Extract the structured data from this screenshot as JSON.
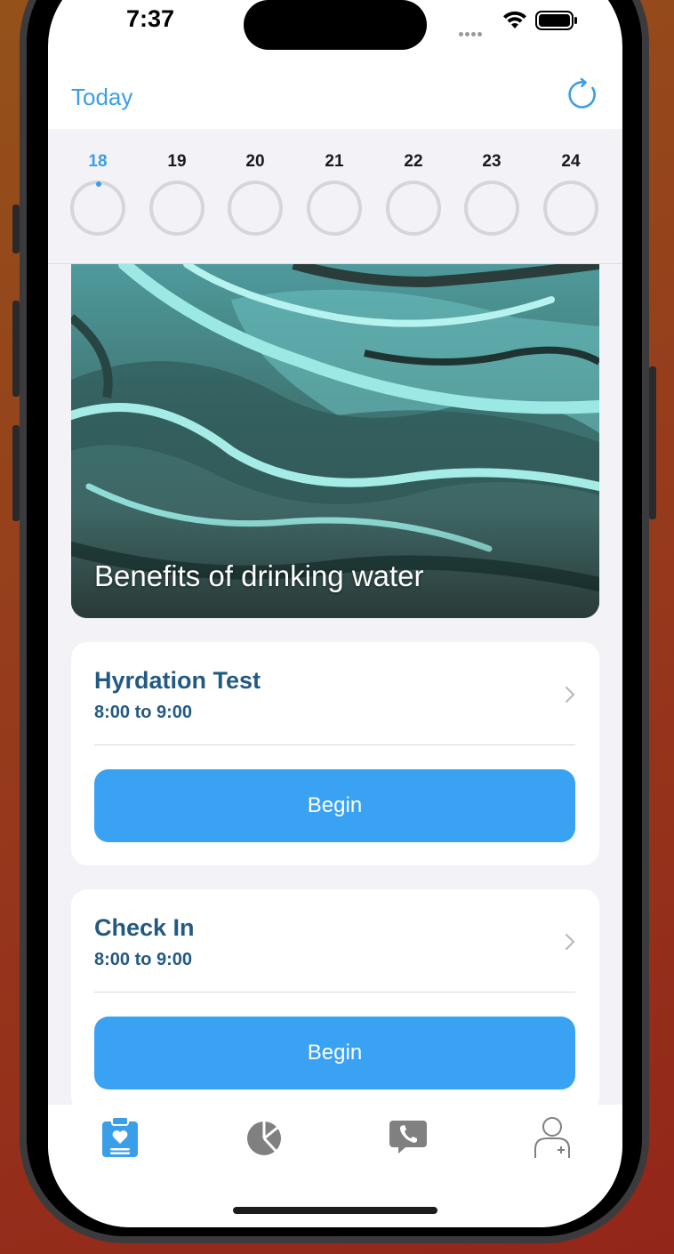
{
  "status_bar": {
    "time": "7:37"
  },
  "nav": {
    "title": "Today"
  },
  "week": {
    "days": [
      "18",
      "19",
      "20",
      "21",
      "22",
      "23",
      "24"
    ],
    "selected_day": "18"
  },
  "hero": {
    "caption": "Benefits of drinking water"
  },
  "tasks": [
    {
      "title": "Hyrdation Test",
      "time": "8:00 to 9:00",
      "button": "Begin"
    },
    {
      "title": "Check In",
      "time": "8:00 to 9:00",
      "button": "Begin"
    }
  ],
  "tab_bar": {
    "items": [
      {
        "icon": "clipboard-heart-icon",
        "active": true
      },
      {
        "icon": "pie-chart-icon",
        "active": false
      },
      {
        "icon": "chat-phone-icon",
        "active": false
      },
      {
        "icon": "profile-icon",
        "active": false
      }
    ]
  },
  "colors": {
    "accent": "#3a9ee8",
    "button": "#3aa2f2",
    "card_title": "#235a82",
    "background": "#f2f2f7"
  }
}
